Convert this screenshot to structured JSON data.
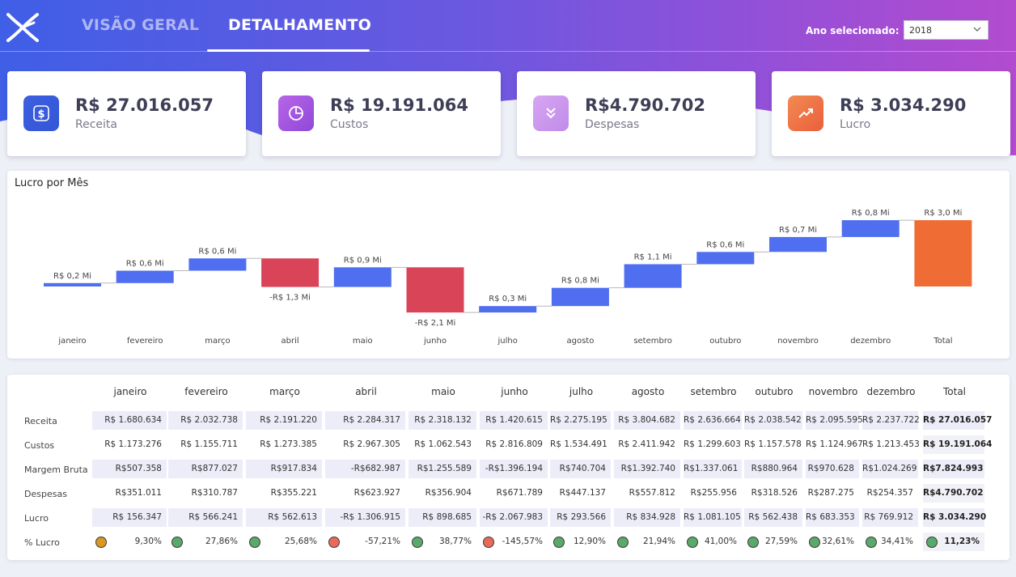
{
  "nav": {
    "tabs": [
      {
        "label": "VISÃO GERAL",
        "active": false
      },
      {
        "label": "DETALHAMENTO",
        "active": true
      }
    ],
    "year_label": "Ano selecionado:",
    "year_value": "2018"
  },
  "kpis": [
    {
      "value": "R$ 27.016.057",
      "label": "Receita",
      "icon": "dollar-icon",
      "color_from": "#3d5fe0",
      "color_to": "#3357d6"
    },
    {
      "value": "R$ 19.191.064",
      "label": "Custos",
      "icon": "pie-chart-icon",
      "color_from": "#b865e8",
      "color_to": "#8f49d8"
    },
    {
      "value": "R$4.790.702",
      "label": "Despesas",
      "icon": "chevrons-down-icon",
      "color_from": "#d7a6f2",
      "color_to": "#c08be8"
    },
    {
      "value": "R$ 3.034.290",
      "label": "Lucro",
      "icon": "trending-up-icon",
      "color_from": "#f28a52",
      "color_to": "#ea5f3d"
    }
  ],
  "chart_data": {
    "type": "waterfall",
    "title": "Lucro por Mês",
    "categories": [
      "janeiro",
      "fevereiro",
      "março",
      "abril",
      "maio",
      "junho",
      "julho",
      "agosto",
      "setembro",
      "outubro",
      "novembro",
      "dezembro",
      "Total"
    ],
    "values": [
      0.156,
      0.566,
      0.563,
      -1.307,
      0.899,
      -2.068,
      0.294,
      0.835,
      1.081,
      0.562,
      0.683,
      0.77,
      3.034
    ],
    "data_labels": [
      "R$ 0,2 Mi",
      "R$ 0,6 Mi",
      "R$ 0,6 Mi",
      "-R$ 1,3 Mi",
      "R$ 0,9 Mi",
      "-R$ 2,1 Mi",
      "R$ 0,3 Mi",
      "R$ 0,8 Mi",
      "R$ 1,1 Mi",
      "R$ 0,6 Mi",
      "R$ 0,7 Mi",
      "R$ 0,8 Mi",
      "R$ 3,0 Mi"
    ],
    "unit": "Mi",
    "colors": {
      "increase": "#4f6ef0",
      "decrease": "#d94459",
      "total": "#ef6c35"
    }
  },
  "table": {
    "columns": [
      "janeiro",
      "fevereiro",
      "março",
      "abril",
      "maio",
      "junho",
      "julho",
      "agosto",
      "setembro",
      "outubro",
      "novembro",
      "dezembro",
      "Total"
    ],
    "rows": [
      {
        "label": "Receita",
        "cells": [
          "R$ 1.680.634",
          "R$ 2.032.738",
          "R$ 2.191.220",
          "R$ 2.284.317",
          "R$ 2.318.132",
          "R$ 1.420.615",
          "R$ 2.275.195",
          "R$ 3.804.682",
          "R$ 2.636.664",
          "R$ 2.038.542",
          "R$ 2.095.595",
          "R$ 2.237.722",
          "R$ 27.016.057"
        ]
      },
      {
        "label": "Custos",
        "cells": [
          "R$ 1.173.276",
          "R$ 1.155.711",
          "R$ 1.273.385",
          "R$ 2.967.305",
          "R$ 1.062.543",
          "R$ 2.816.809",
          "R$ 1.534.491",
          "R$ 2.411.942",
          "R$ 1.299.603",
          "R$ 1.157.578",
          "R$ 1.124.967",
          "R$ 1.213.453",
          "R$ 19.191.064"
        ]
      },
      {
        "label": "Margem Bruta",
        "cells": [
          "R$507.358",
          "R$877.027",
          "R$917.834",
          "-R$682.987",
          "R$1.255.589",
          "-R$1.396.194",
          "R$740.704",
          "R$1.392.740",
          "R$1.337.061",
          "R$880.964",
          "R$970.628",
          "R$1.024.269",
          "R$7.824.993"
        ]
      },
      {
        "label": "Despesas",
        "cells": [
          "R$351.011",
          "R$310.787",
          "R$355.221",
          "R$623.927",
          "R$356.904",
          "R$671.789",
          "R$447.137",
          "R$557.812",
          "R$255.956",
          "R$318.526",
          "R$287.275",
          "R$254.357",
          "R$4.790.702"
        ]
      },
      {
        "label": "Lucro",
        "cells": [
          "R$ 156.347",
          "R$ 566.241",
          "R$ 562.613",
          "-R$ 1.306.915",
          "R$ 898.685",
          "-R$ 2.067.983",
          "R$ 293.566",
          "R$ 834.928",
          "R$ 1.081.105",
          "R$ 562.438",
          "R$ 683.353",
          "R$ 769.912",
          "R$ 3.034.290"
        ]
      },
      {
        "label": "% Lucro",
        "cells": [
          "9,30%",
          "27,86%",
          "25,68%",
          "-57,21%",
          "38,77%",
          "-145,57%",
          "12,90%",
          "21,94%",
          "41,00%",
          "27,59%",
          "32,61%",
          "34,41%",
          "11,23%"
        ],
        "status": [
          "amber",
          "green",
          "green",
          "red",
          "green",
          "red",
          "green",
          "green",
          "green",
          "green",
          "green",
          "green",
          "green"
        ]
      }
    ],
    "status_colors": {
      "green": "#5aa86b",
      "amber": "#d9981f",
      "red": "#e86a5a"
    }
  }
}
